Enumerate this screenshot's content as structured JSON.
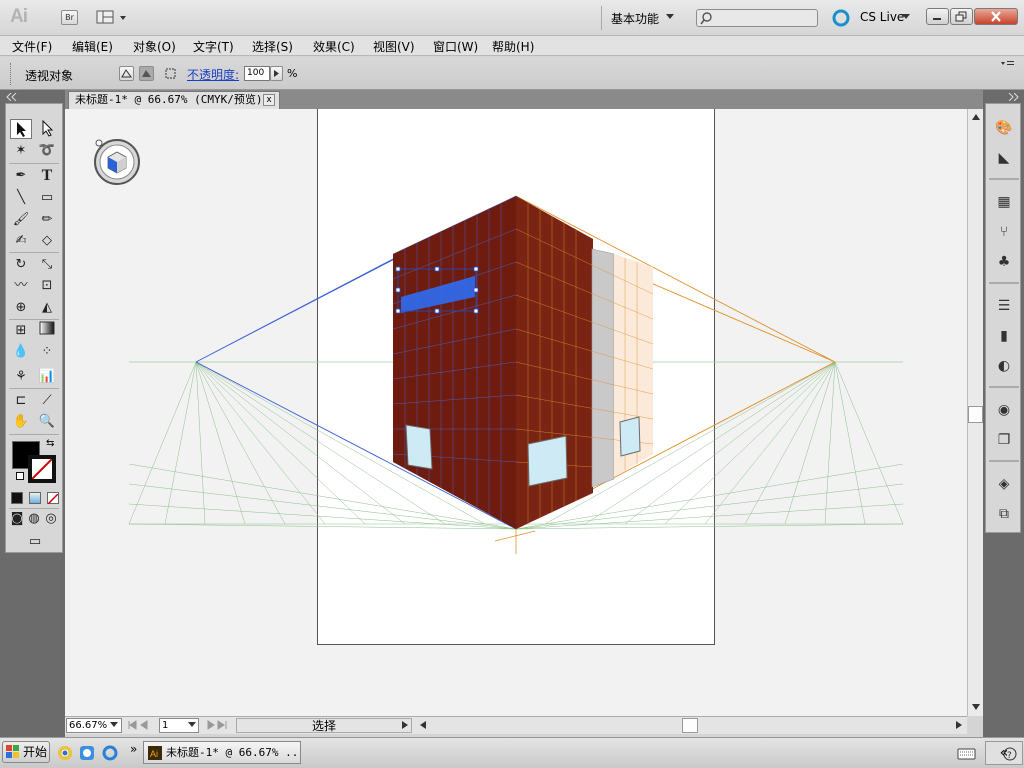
{
  "titlebar": {
    "logo": "Ai",
    "bridge_label": "Br",
    "workspace": "基本功能",
    "cs_live": "CS Live"
  },
  "menubar": {
    "items": [
      "文件(F)",
      "编辑(E)",
      "对象(O)",
      "文字(T)",
      "选择(S)",
      "效果(C)",
      "视图(V)",
      "窗口(W)",
      "帮助(H)"
    ]
  },
  "controlbar": {
    "label": "透视对象",
    "opacity_label": "不透明度:",
    "opacity_value": "100",
    "opacity_unit": "%"
  },
  "document": {
    "tab_title": "未标题-1* @ 66.67% (CMYK/预览)",
    "tab_close": "x"
  },
  "statusbar": {
    "zoom": "66.67%",
    "page": "1",
    "status": "选择"
  },
  "taskbar": {
    "start": "开始",
    "task_label": "未标题-1* @ 66.67% ..."
  },
  "colors": {
    "accent": "#3a7fcf",
    "wall": "#6e1c10",
    "grid_left": "#3b5cc9",
    "grid_right": "#e0902a",
    "ground": "#7fb07f"
  }
}
